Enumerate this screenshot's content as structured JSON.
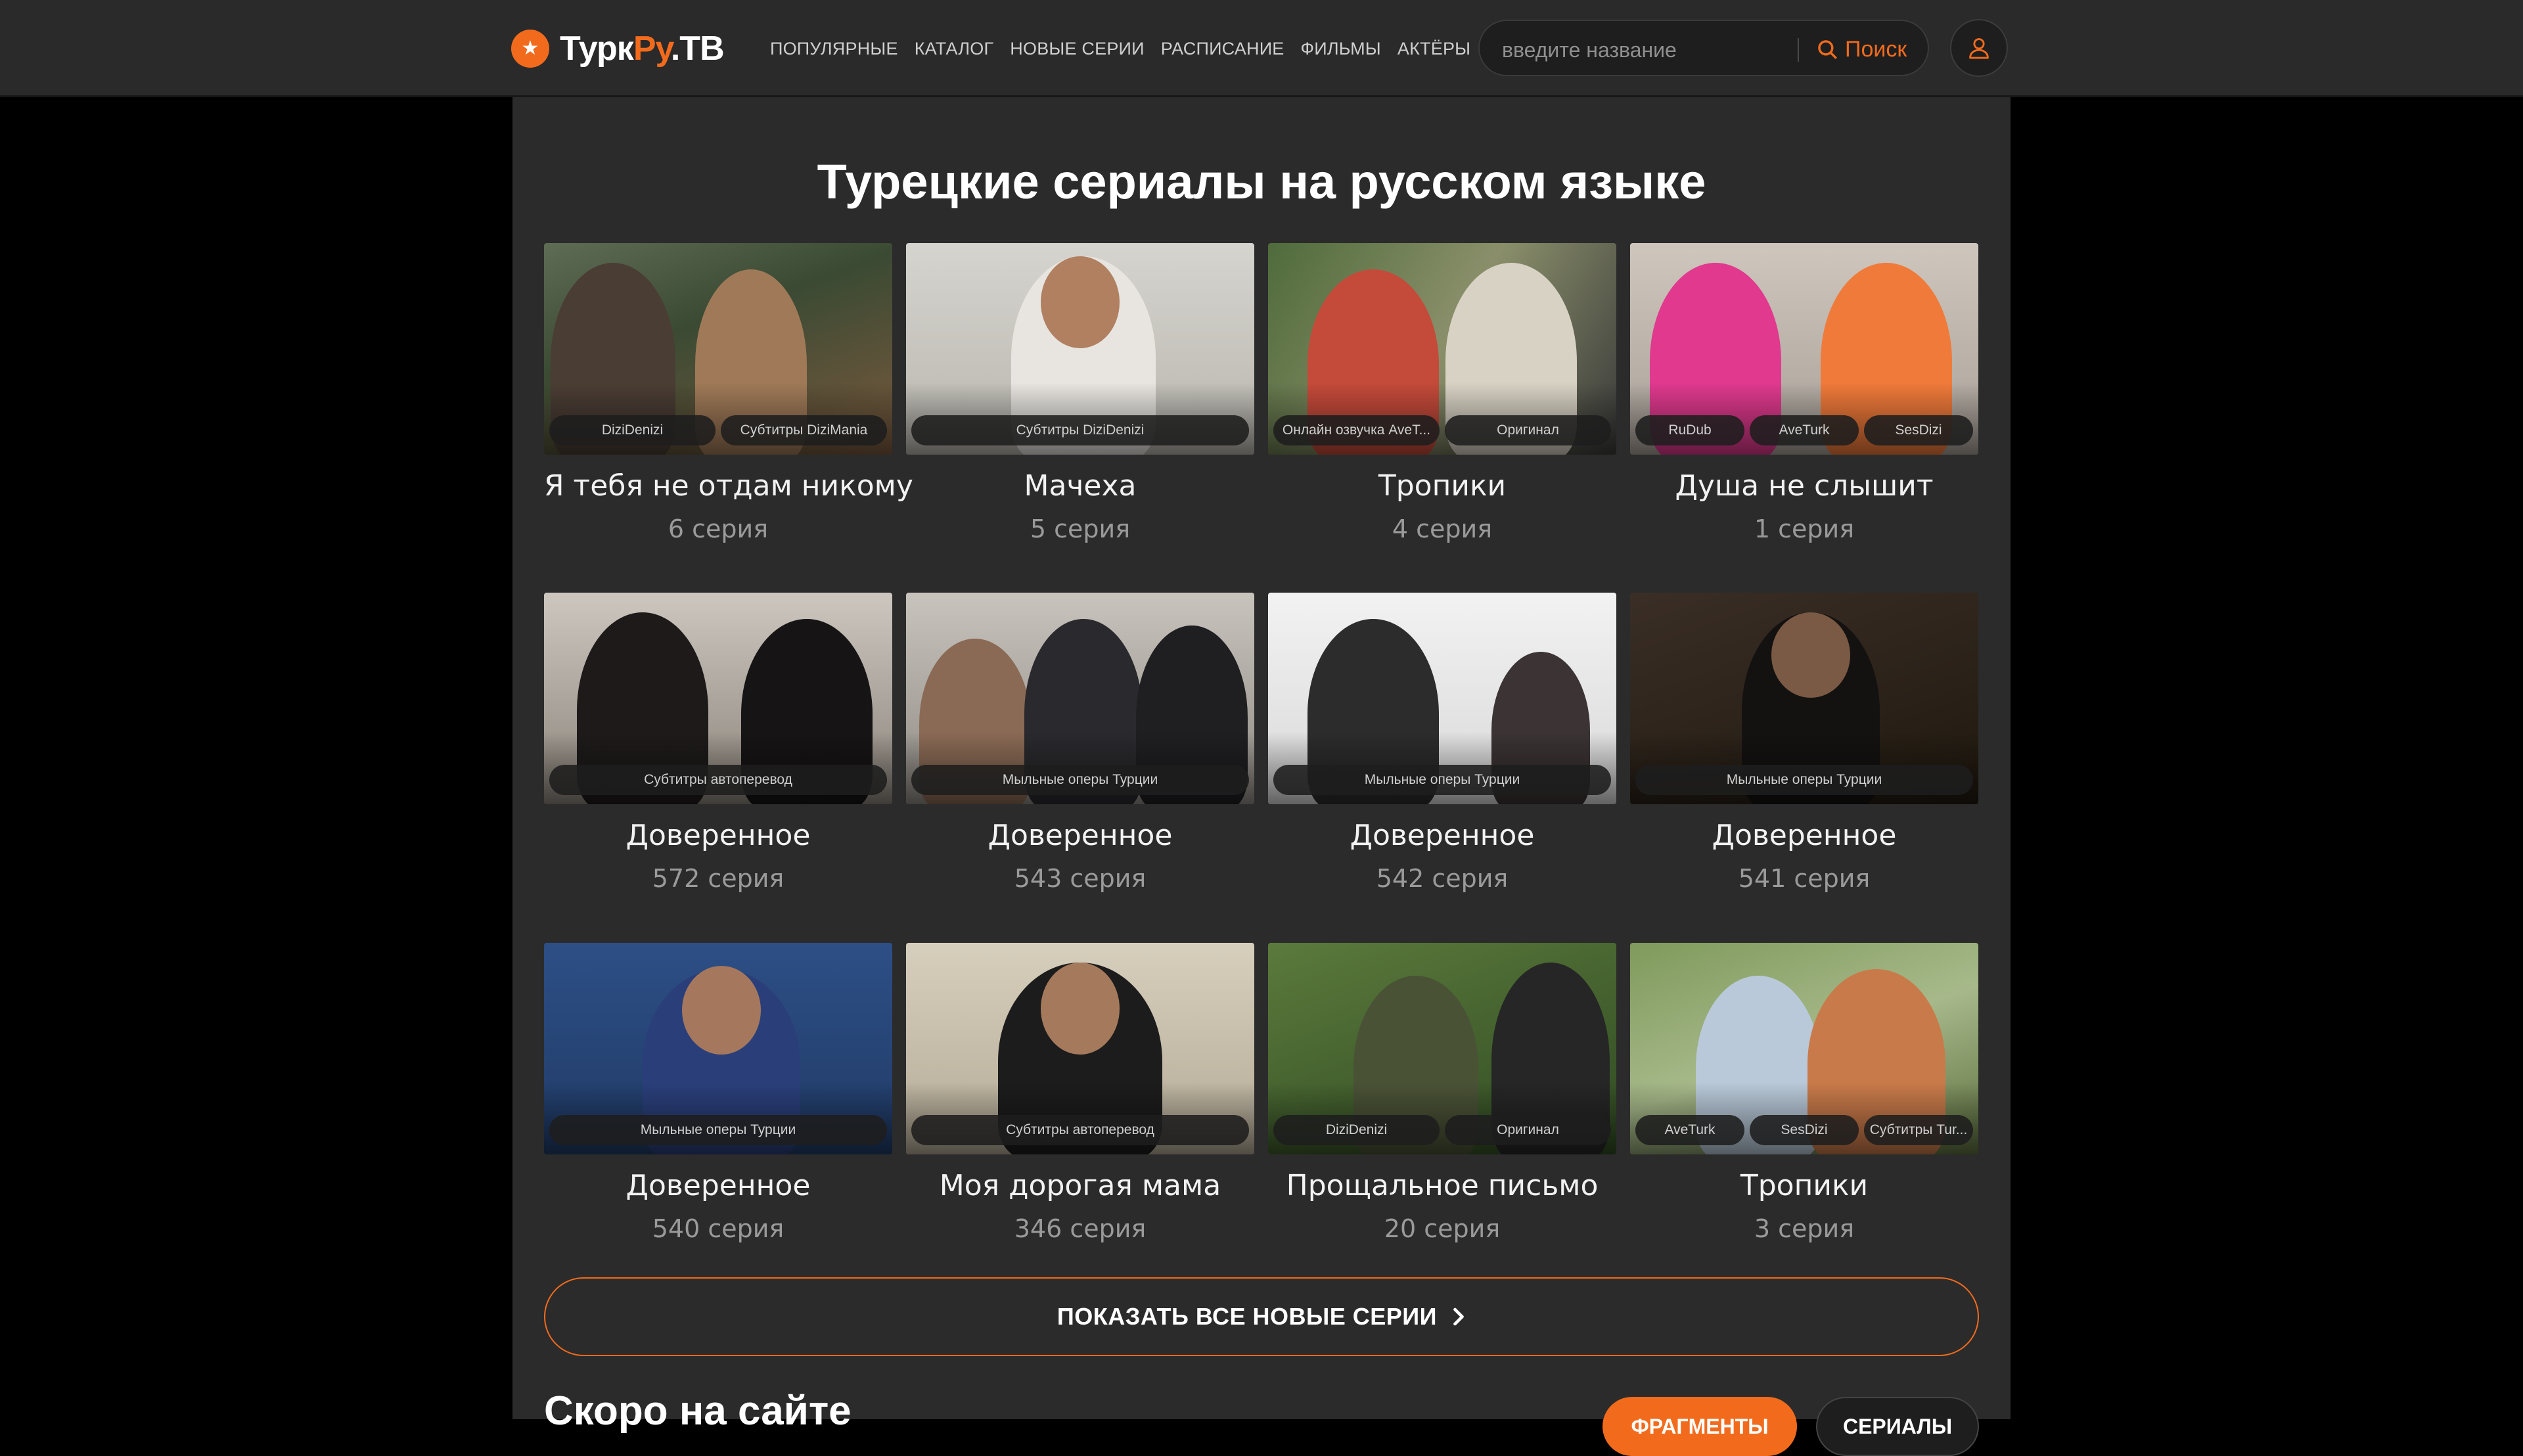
{
  "header": {
    "logo": {
      "part1": "Турк",
      "part2": "Ру",
      "part3": ".ТВ"
    },
    "nav": [
      {
        "label": "ПОПУЛЯРНЫЕ"
      },
      {
        "label": "КАТАЛОГ"
      },
      {
        "label": "НОВЫЕ СЕРИИ"
      },
      {
        "label": "РАСПИСАНИЕ"
      },
      {
        "label": "ФИЛЬМЫ"
      },
      {
        "label": "АКТЁРЫ"
      }
    ],
    "search": {
      "placeholder": "введите название",
      "button_label": "Поиск"
    }
  },
  "main": {
    "title": "Турецкие сериалы на русском языке",
    "cards": [
      {
        "title": "Я тебя не отдам никому",
        "episode": "6 серия",
        "tags": [
          "DiziDenizi",
          "Субтитры DiziMania"
        ]
      },
      {
        "title": "Мачеха",
        "episode": "5 серия",
        "tags": [
          "Субтитры DiziDenizi"
        ]
      },
      {
        "title": "Тропики",
        "episode": "4 серия",
        "tags": [
          "Онлайн озвучка AveT...",
          "Оригинал"
        ]
      },
      {
        "title": "Душа не слышит",
        "episode": "1 серия",
        "tags": [
          "RuDub",
          "AveTurk",
          "SesDizi"
        ]
      },
      {
        "title": "Доверенное",
        "episode": "572 серия",
        "tags": [
          "Субтитры автоперевод"
        ]
      },
      {
        "title": "Доверенное",
        "episode": "543 серия",
        "tags": [
          "Мыльные оперы Турции"
        ]
      },
      {
        "title": "Доверенное",
        "episode": "542 серия",
        "tags": [
          "Мыльные оперы Турции"
        ]
      },
      {
        "title": "Доверенное",
        "episode": "541 серия",
        "tags": [
          "Мыльные оперы Турции"
        ]
      },
      {
        "title": "Доверенное",
        "episode": "540 серия",
        "tags": [
          "Мыльные оперы Турции"
        ]
      },
      {
        "title": "Моя дорогая мама",
        "episode": "346 серия",
        "tags": [
          "Субтитры автоперевод"
        ]
      },
      {
        "title": "Прощальное письмо",
        "episode": "20 серия",
        "tags": [
          "DiziDenizi",
          "Оригинал"
        ]
      },
      {
        "title": "Тропики",
        "episode": "3 серия",
        "tags": [
          "AveTurk",
          "SesDizi",
          "Субтитры Tur..."
        ]
      }
    ],
    "show_all_label": "ПОКАЗАТЬ ВСЕ НОВЫЕ СЕРИИ",
    "section_title": "Скоро на сайте",
    "section_tabs": [
      {
        "label": "ФРАГМЕНТЫ"
      },
      {
        "label": "СЕРИАЛЫ"
      }
    ]
  },
  "colors": {
    "accent": "#f26b1d",
    "header_bg": "#2a2a2a",
    "content_bg": "#2b2b2b",
    "page_bg": "#000000"
  },
  "icons": [
    "logo-star-icon",
    "search-icon",
    "user-icon",
    "chevron-right-icon"
  ]
}
